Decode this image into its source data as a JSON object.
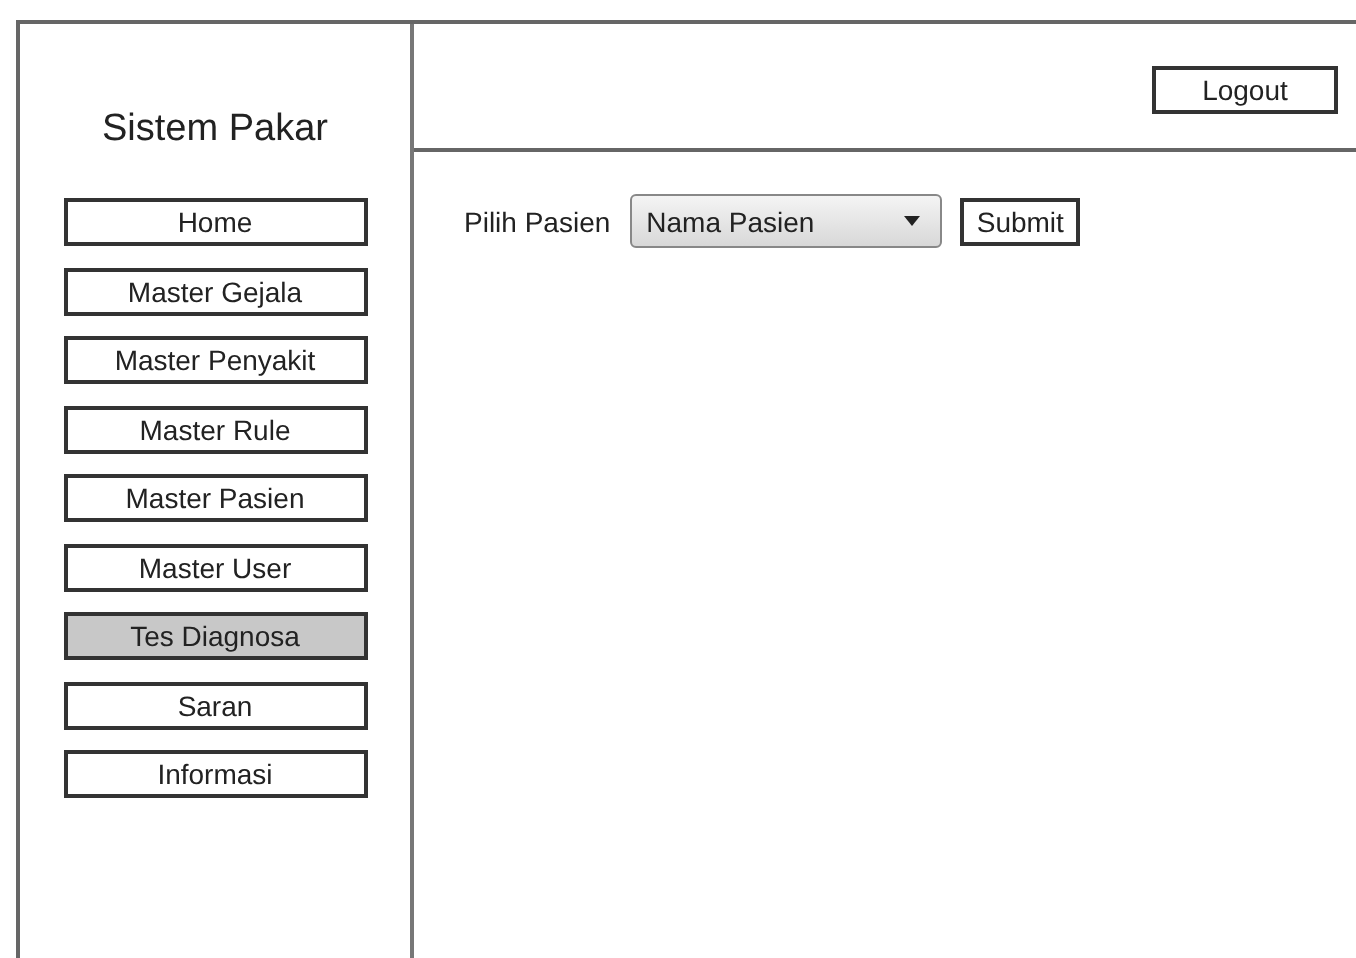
{
  "sidebar": {
    "title": "Sistem Pakar",
    "items": [
      {
        "label": "Home",
        "selected": false
      },
      {
        "label": "Master Gejala",
        "selected": false
      },
      {
        "label": "Master Penyakit",
        "selected": false
      },
      {
        "label": "Master Rule",
        "selected": false
      },
      {
        "label": "Master Pasien",
        "selected": false
      },
      {
        "label": "Master User",
        "selected": false
      },
      {
        "label": "Tes Diagnosa",
        "selected": true
      },
      {
        "label": "Saran",
        "selected": false
      },
      {
        "label": "Informasi",
        "selected": false
      }
    ]
  },
  "header": {
    "logout": "Logout"
  },
  "form": {
    "label": "Pilih Pasien",
    "select": {
      "value": "Nama Pasien"
    },
    "submit": "Submit"
  }
}
